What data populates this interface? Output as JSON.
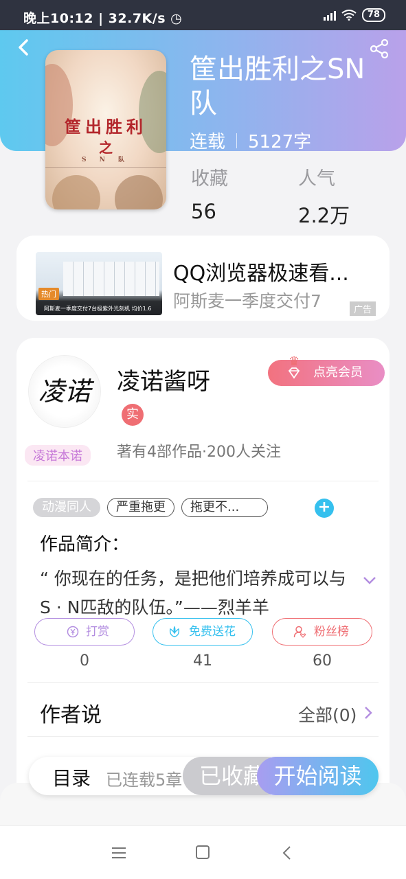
{
  "status": {
    "time": "晚上10:12",
    "speed": "32.7K/s",
    "battery": "78"
  },
  "book": {
    "title": "筐出胜利之SN队",
    "state": "连载",
    "words": "5127字",
    "cover_title_1": "筐出胜利",
    "cover_title_2": "之",
    "cover_title_3": "S N 队",
    "stats": [
      {
        "label": "收藏",
        "value": "56"
      },
      {
        "label": "人气",
        "value": "2.2万"
      }
    ]
  },
  "ad": {
    "title": "QQ浏览器极速看...",
    "subtitle": "阿斯麦一季度交付7",
    "tag": "广告",
    "hot_label": "热门",
    "caption": "阿斯麦一季度交付7台极紫外光刻机 均价1.6"
  },
  "author": {
    "avatar_text": "凌诺",
    "name": "凌诺酱呀",
    "verified_badge": "实",
    "badge_label": "凌诺本诺",
    "vip_button": "点亮会员",
    "works_info": "著有4部作品·200人关注"
  },
  "tags": [
    "动漫同人",
    "严重拖更",
    "拖更不..."
  ],
  "intro": {
    "heading": "作品简介：",
    "text": "“ 你现在的任务，是把他们培养成可以与S · N匹敌的队伍。”——烈羊羊"
  },
  "actions": [
    {
      "label": "打赏",
      "count": "0",
      "color": "#b38ee0"
    },
    {
      "label": "免费送花",
      "count": "41",
      "color": "#35c0ee"
    },
    {
      "label": "粉丝榜",
      "count": "60",
      "color": "#ef6e73"
    }
  ],
  "author_says": {
    "label": "作者说",
    "all": "全部(0)"
  },
  "bottom": {
    "catalog": "目录",
    "status": "已连载5章",
    "collected": "已收藏",
    "read": "开始阅读"
  }
}
